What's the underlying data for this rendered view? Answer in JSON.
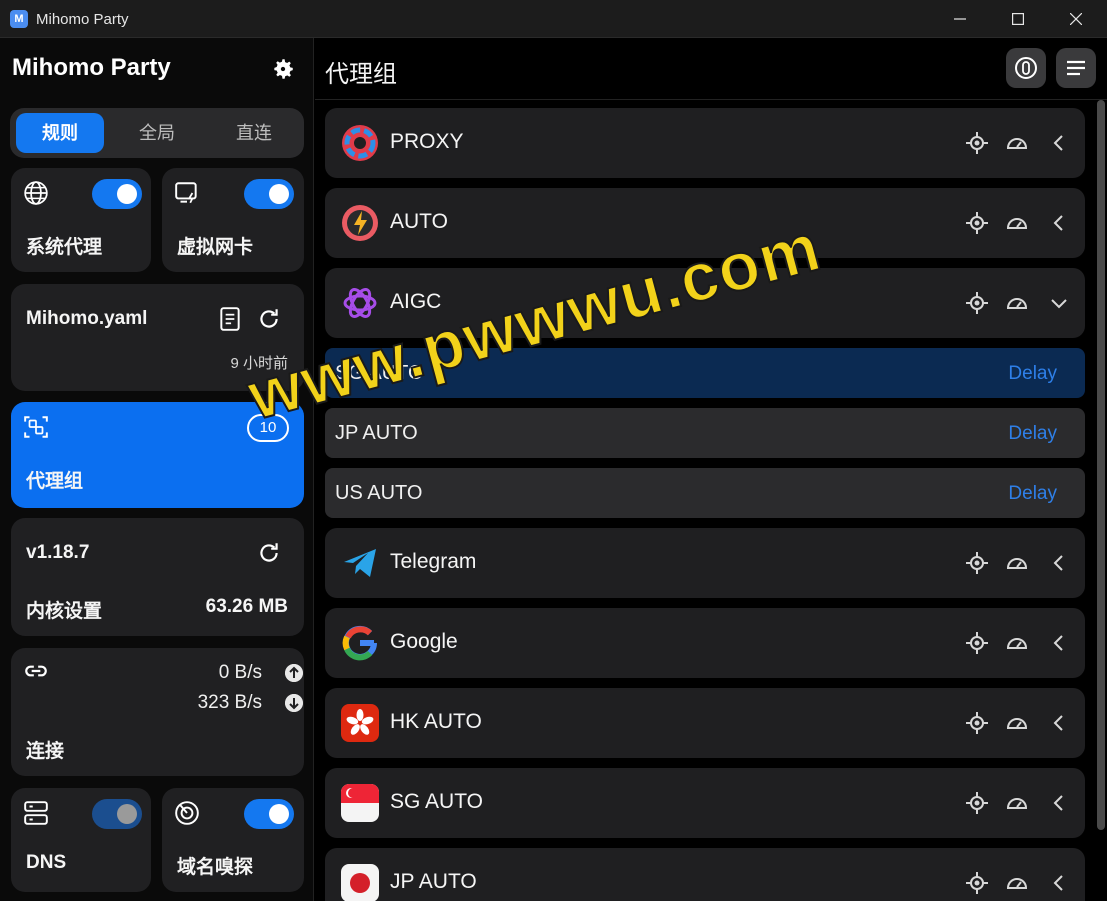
{
  "window": {
    "title": "Mihomo Party",
    "logo_letter": "M",
    "controls": [
      "—",
      "☐",
      "✕"
    ]
  },
  "sidebar": {
    "title": "Mihomo Party",
    "modes": [
      {
        "label": "规则",
        "active": true
      },
      {
        "label": "全局",
        "active": false
      },
      {
        "label": "直连",
        "active": false
      }
    ],
    "system_proxy": {
      "label": "系统代理",
      "enabled": true,
      "icon": "globe-icon"
    },
    "tun": {
      "label": "虚拟网卡",
      "enabled": true,
      "icon": "tun-icon"
    },
    "profile": {
      "name": "Mihomo.yaml",
      "updated": "9 小时前"
    },
    "proxy_groups": {
      "label": "代理组",
      "count": "10",
      "active": true
    },
    "core": {
      "version": "v1.18.7",
      "label": "内核设置",
      "memory": "63.26 MB"
    },
    "connections": {
      "label": "连接",
      "upload": "0 B/s",
      "download": "323 B/s"
    },
    "dns": {
      "label": "DNS",
      "enabled": false
    },
    "sniff": {
      "label": "域名嗅探",
      "enabled": true
    }
  },
  "main": {
    "title": "代理组",
    "groups": [
      {
        "name": "PROXY",
        "icon": "proxy-icon",
        "expanded": false
      },
      {
        "name": "AUTO",
        "icon": "auto-icon",
        "expanded": false
      },
      {
        "name": "AIGC",
        "icon": "openai-icon",
        "expanded": true
      }
    ],
    "aigc_children": [
      {
        "name": "SG AUTO",
        "delay": "Delay",
        "selected": true
      },
      {
        "name": "JP AUTO",
        "delay": "Delay",
        "selected": false
      },
      {
        "name": "US AUTO",
        "delay": "Delay",
        "selected": false
      }
    ],
    "groups_after": [
      {
        "name": "Telegram",
        "icon": "telegram-icon"
      },
      {
        "name": "Google",
        "icon": "google-icon"
      },
      {
        "name": "HK AUTO",
        "icon": "hk-flag-icon"
      },
      {
        "name": "SG AUTO",
        "icon": "sg-flag-icon"
      },
      {
        "name": "JP AUTO",
        "icon": "jp-flag-icon"
      }
    ]
  },
  "watermark": "www.pwwwu.com",
  "colors": {
    "accent": "#1478f0",
    "card": "#202022",
    "background": "#000000",
    "delay_text": "#2e7fe8",
    "watermark": "#f2d21a"
  }
}
